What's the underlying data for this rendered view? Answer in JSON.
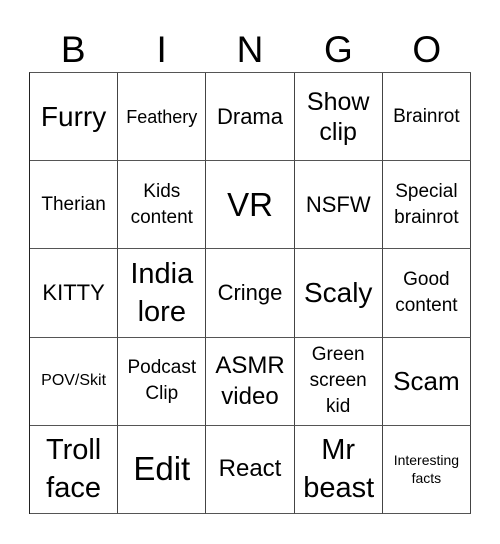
{
  "header": {
    "letters": [
      "B",
      "I",
      "N",
      "G",
      "O"
    ]
  },
  "card": {
    "rows": [
      [
        "Furry",
        "Feathery",
        "Drama",
        "Show clip",
        "Brainrot"
      ],
      [
        "Therian",
        "Kids content",
        "VR",
        "NSFW",
        "Special brainrot"
      ],
      [
        "KITTY",
        "India lore",
        "Cringe",
        "Scaly",
        "Good content"
      ],
      [
        "POV/Skit",
        "Podcast Clip",
        "ASMR video",
        "Green screen kid",
        "Scam"
      ],
      [
        "Troll face",
        "Edit",
        "React",
        "Mr beast",
        "Interesting facts"
      ]
    ]
  }
}
